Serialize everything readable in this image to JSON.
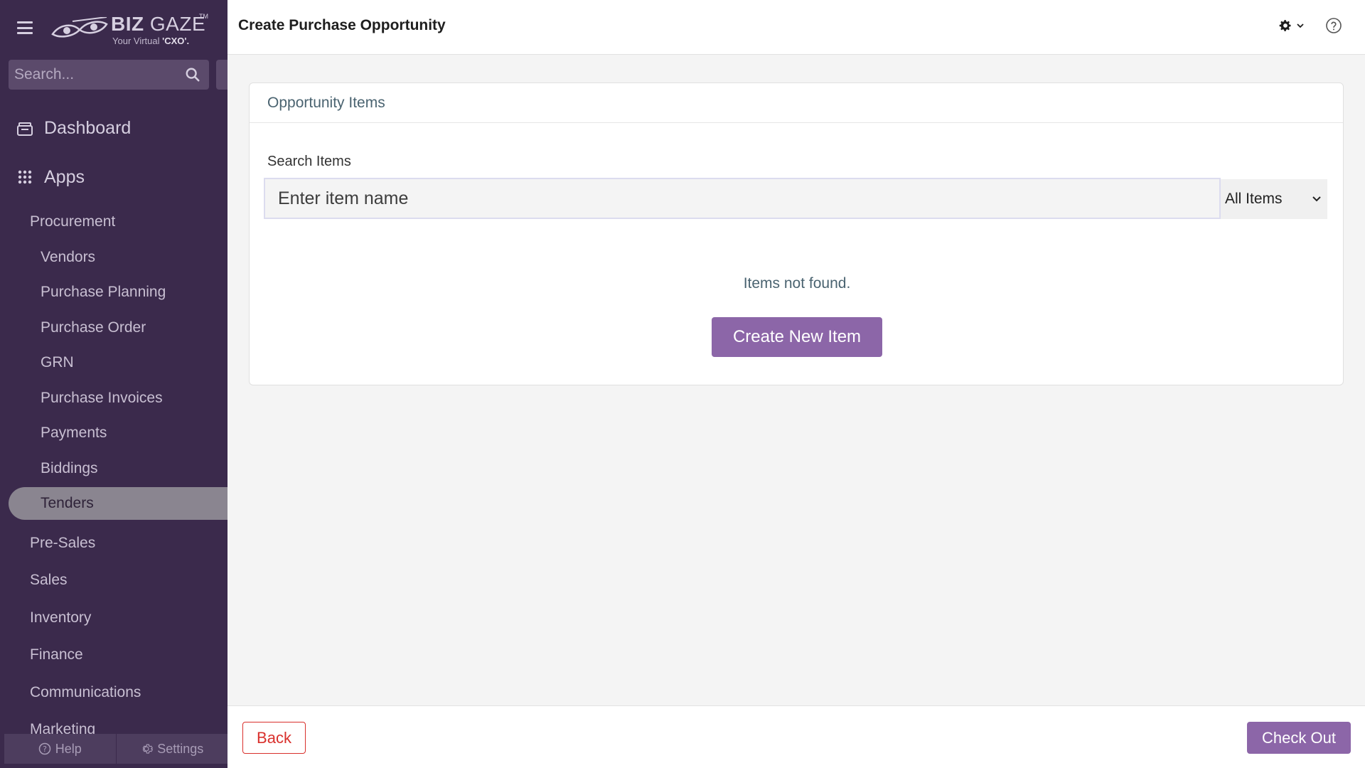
{
  "brand": {
    "logo_biz": "BIZ",
    "logo_gaze": "GAZE",
    "logo_tm": "TM",
    "tagline_prefix": "Your Virtual ",
    "tagline_bold": "'CXO'."
  },
  "sidebar": {
    "search_placeholder": "Search...",
    "dashboard": "Dashboard",
    "apps": "Apps",
    "procurement": "Procurement",
    "procurement_items": [
      "Vendors",
      "Purchase Planning",
      "Purchase Order",
      "GRN",
      "Purchase Invoices",
      "Payments",
      "Biddings",
      "Tenders"
    ],
    "active_item": "Tenders",
    "sections": [
      "Pre-Sales",
      "Sales",
      "Inventory",
      "Finance",
      "Communications",
      "Marketing"
    ],
    "footer": {
      "help": "Help",
      "settings": "Settings"
    }
  },
  "header": {
    "title": "Create Purchase Opportunity"
  },
  "card": {
    "heading": "Opportunity Items",
    "search_label": "Search Items",
    "search_placeholder": "Enter item name",
    "filter_value": "All Items",
    "empty_message": "Items not found.",
    "create_button": "Create New Item"
  },
  "footer": {
    "back": "Back",
    "checkout": "Check Out"
  },
  "colors": {
    "sidebar_bg": "#3b2a4c",
    "accent": "#8c66a8",
    "danger": "#d9302c"
  }
}
